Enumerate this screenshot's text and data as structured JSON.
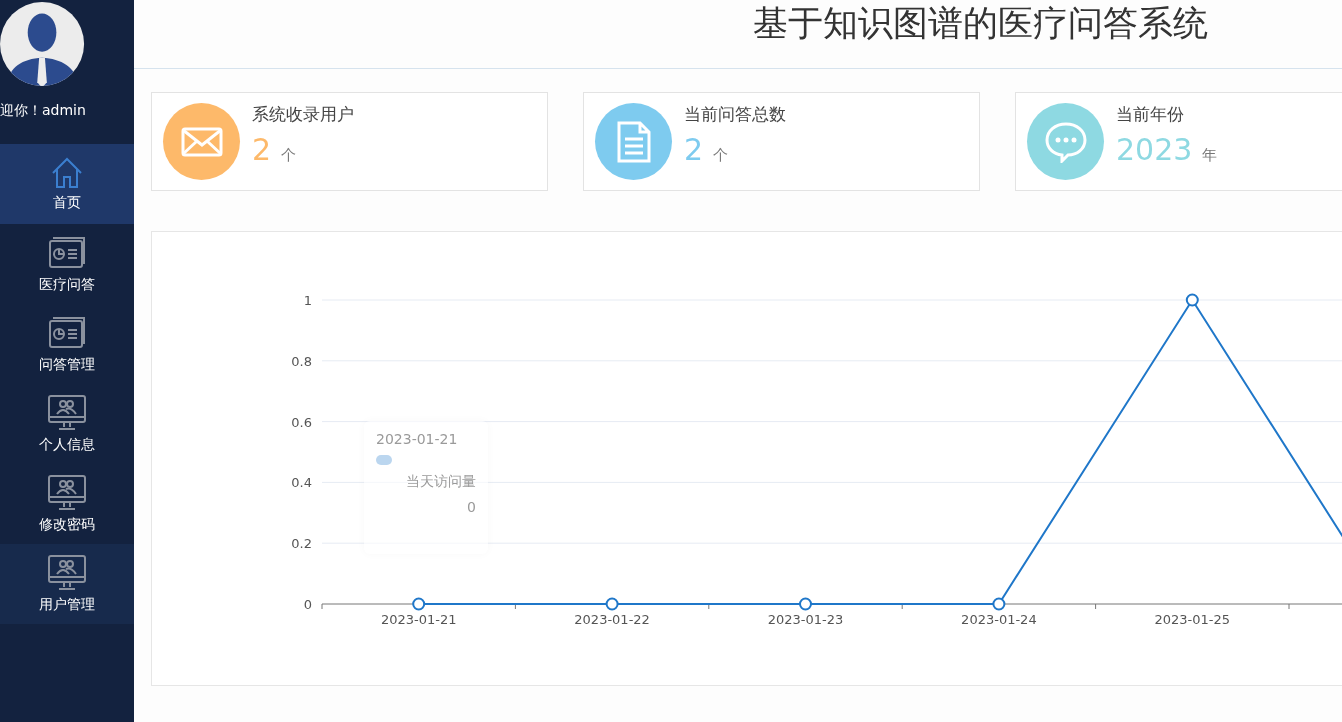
{
  "sidebar": {
    "welcome": "迎你！admin",
    "items": [
      {
        "label": "首页",
        "kind": "home",
        "selected": true,
        "hovered": false
      },
      {
        "label": "医疗问答",
        "kind": "report",
        "selected": false,
        "hovered": false
      },
      {
        "label": "问答管理",
        "kind": "report",
        "selected": false,
        "hovered": false
      },
      {
        "label": "个人信息",
        "kind": "monitor",
        "selected": false,
        "hovered": false
      },
      {
        "label": "修改密码",
        "kind": "monitor",
        "selected": false,
        "hovered": false
      },
      {
        "label": "用户管理",
        "kind": "monitor",
        "selected": false,
        "hovered": true
      }
    ]
  },
  "header": {
    "title": "基于知识图谱的医疗问答系统"
  },
  "stats": [
    {
      "label": "系统收录用户",
      "value": "2",
      "unit": "个",
      "kind": "mail",
      "color": "#fdb96a"
    },
    {
      "label": "当前问答总数",
      "value": "2",
      "unit": "个",
      "kind": "document",
      "color": "#7ecbef"
    },
    {
      "label": "当前年份",
      "value": "2023",
      "unit": "年",
      "kind": "chat",
      "color": "#8ed9e2"
    }
  ],
  "chart": {
    "chart_data": {
      "type": "line",
      "grid": true,
      "categories": [
        "2023-01-21",
        "2023-01-22",
        "2023-01-23",
        "2023-01-24",
        "2023-01-25"
      ],
      "ylim": [
        0,
        1
      ],
      "yticks": [
        0,
        0.2,
        0.4,
        0.6,
        0.8,
        1
      ],
      "series": [
        {
          "name": "当天访问量",
          "color": "#1f77c9",
          "marker": "circle",
          "values": [
            0,
            0,
            0,
            0,
            1
          ]
        }
      ]
    },
    "tooltip": {
      "title": "2023-01-21",
      "value": "0"
    }
  }
}
